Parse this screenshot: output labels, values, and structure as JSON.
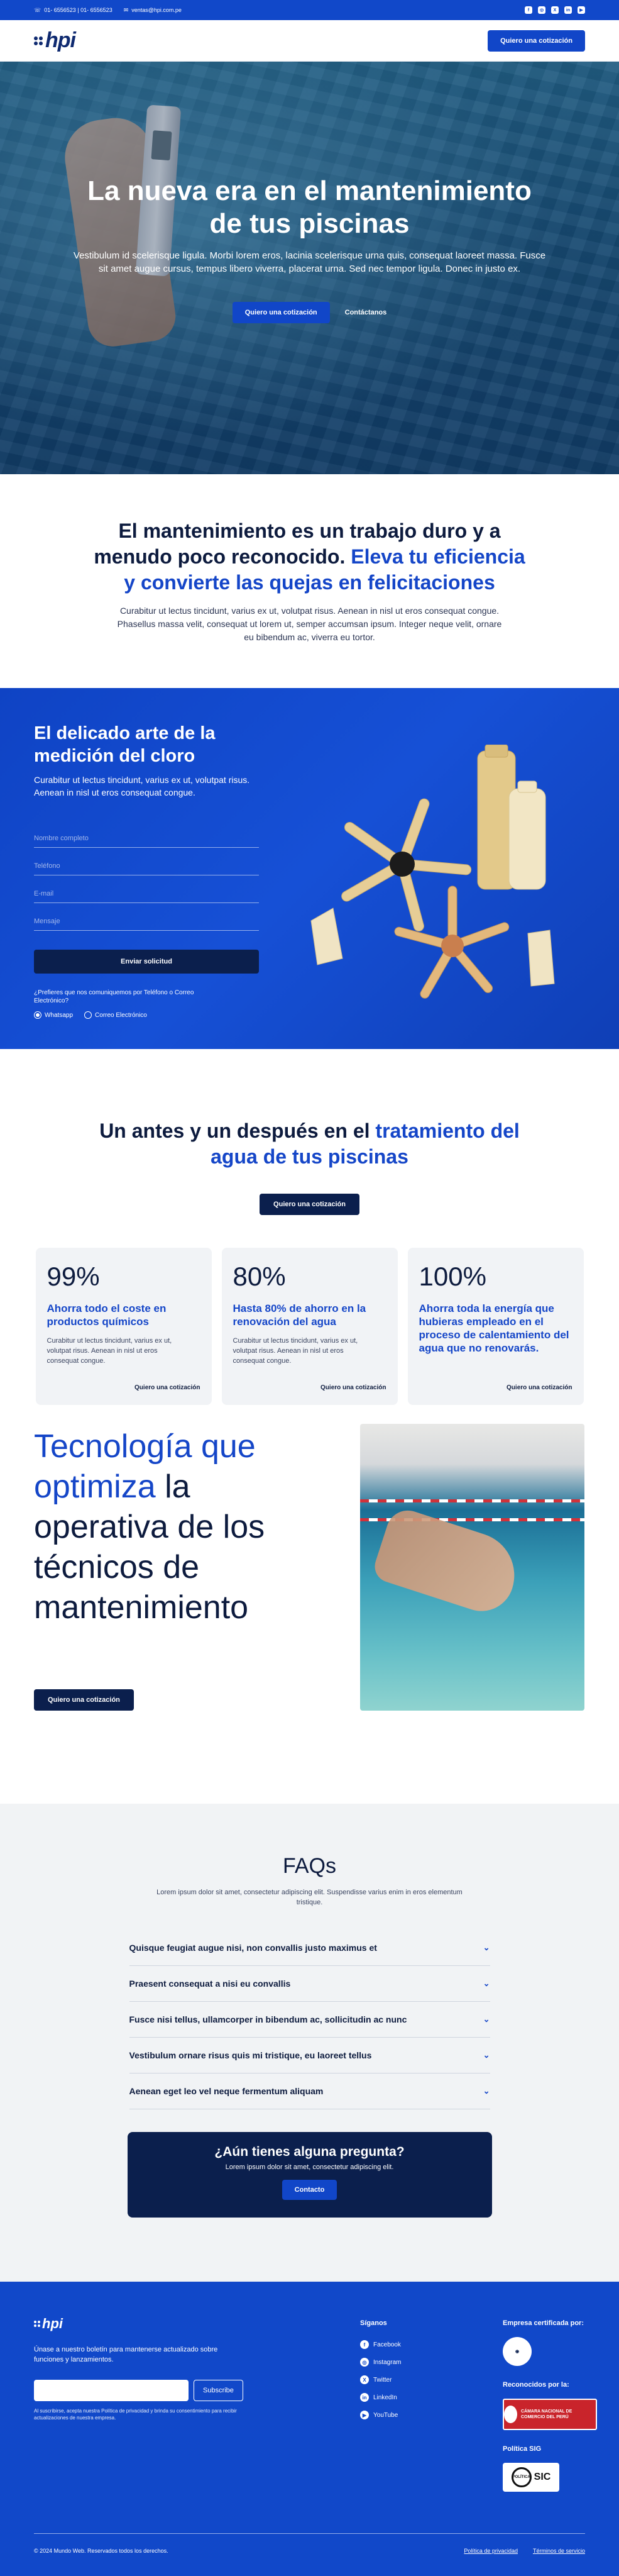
{
  "topbar": {
    "phone": "01- 6556523 | 01- 6556523",
    "email": "ventas@hpi.com.pe",
    "socials": [
      "facebook-icon",
      "instagram-icon",
      "x-icon",
      "linkedin-icon",
      "youtube-icon"
    ]
  },
  "header": {
    "logo_text": "hpi",
    "cta": "Quiero una cotización"
  },
  "hero": {
    "title": "La nueva era en el mantenimiento de tus piscinas",
    "text": "Vestibulum id scelerisque ligula. Morbi lorem eros, lacinia scelerisque urna quis, consequat laoreet massa. Fusce sit amet augue cursus, tempus libero viverra, placerat urna. Sed nec tempor ligula. Donec in justo ex.",
    "cta_primary": "Quiero una cotización",
    "cta_secondary": "Contáctanos"
  },
  "intro": {
    "title_dark": "El mantenimiento es un trabajo duro y a menudo poco reconocido.",
    "title_accent": "Eleva tu eficiencia y convierte las quejas en felicitaciones",
    "text": "Curabitur ut lectus tincidunt, varius ex ut, volutpat risus. Aenean in nisl ut eros consequat congue. Phasellus massa velit, consequat ut lorem ut, semper accumsan ipsum. Integer neque velit, ornare eu bibendum ac, viverra eu tortor."
  },
  "chlorine": {
    "title": "El delicado arte de la medición del cloro",
    "text": "Curabitur ut lectus tincidunt, varius ex ut, volutpat risus. Aenean in nisl ut eros consequat congue.",
    "fields": {
      "name": "Nombre completo",
      "phone": "Teléfono",
      "email": "E-mail",
      "message": "Mensaje"
    },
    "submit": "Enviar solicitud",
    "preference_question": "¿Prefieres que nos comuniquemos por Teléfono o Correo Electrónico?",
    "options": [
      "Whatsapp",
      "Correo Electrónico"
    ],
    "selected": "Whatsapp"
  },
  "before_after": {
    "title_dark": "Un antes y un después en el",
    "title_accent": "tratamiento del agua de tus piscinas",
    "cta": "Quiero una cotización",
    "cards": [
      {
        "pct": "99%",
        "title": "Ahorra todo el coste en productos químicos",
        "text": "Curabitur ut lectus tincidunt, varius ex ut, volutpat risus. Aenean in nisl ut eros consequat congue.",
        "link": "Quiero una cotización"
      },
      {
        "pct": "80%",
        "title": "Hasta 80% de ahorro en la renovación del agua",
        "text": "Curabitur ut lectus tincidunt, varius ex ut, volutpat risus. Aenean in nisl ut eros consequat congue.",
        "link": "Quiero una cotización"
      },
      {
        "pct": "100%",
        "title": "Ahorra toda la energía que hubieras empleado en el proceso de calentamiento del agua que no renovarás.",
        "text": "",
        "link": "Quiero una cotización"
      }
    ]
  },
  "tech": {
    "title_accent": "Tecnología que optimiza",
    "title_dark": "la operativa de los técnicos de mantenimiento",
    "cta": "Quiero una cotización"
  },
  "faq": {
    "title": "FAQs",
    "subtitle": "Lorem ipsum dolor sit amet, consectetur adipiscing elit. Suspendisse varius enim in eros elementum tristique.",
    "questions": [
      "Quisque feugiat augue nisi, non convallis justo maximus et",
      "Praesent consequat a nisi eu convallis",
      "Fusce nisi tellus, ullamcorper in bibendum ac, sollicitudin ac nunc",
      "Vestibulum ornare risus quis mi tristique, eu laoreet tellus",
      "Aenean eget leo vel neque fermentum aliquam"
    ],
    "contact_title": "¿Aún tienes alguna pregunta?",
    "contact_text": "Lorem ipsum dolor sit amet, consectetur adipiscing elit.",
    "contact_button": "Contacto"
  },
  "footer": {
    "logo_text": "hpi",
    "newsletter_text": "Únase a nuestro boletín para mantenerse actualizado sobre funciones y lanzamientos.",
    "newsletter_button": "Subscribe",
    "legal": "Al suscribirse, acepta nuestra Política de privacidad y brinda su consentimiento para recibir actualizaciones de nuestra empresa.",
    "follow_title": "Síganos",
    "social_links": [
      "Facebook",
      "Instagram",
      "Twitter",
      "LinkedIn",
      "YouTube"
    ],
    "cert_title": "Empresa certificada por:",
    "recognized_title": "Reconocidos por la:",
    "camara_text": "CÁMARA NACIONAL DE COMERCIO DEL PERÚ",
    "policy_title": "Política SIG",
    "sic_text": "SIC",
    "sic_label": "POLÍTICA",
    "copyright": "© 2024 Mundo Web. Reservados todos los derechos.",
    "privacy": "Política de privacidad",
    "terms": "Términos de servicio"
  },
  "colors": {
    "brand_blue": "#1148c9",
    "navy": "#0b1f4d",
    "accent": "#1546c8"
  }
}
